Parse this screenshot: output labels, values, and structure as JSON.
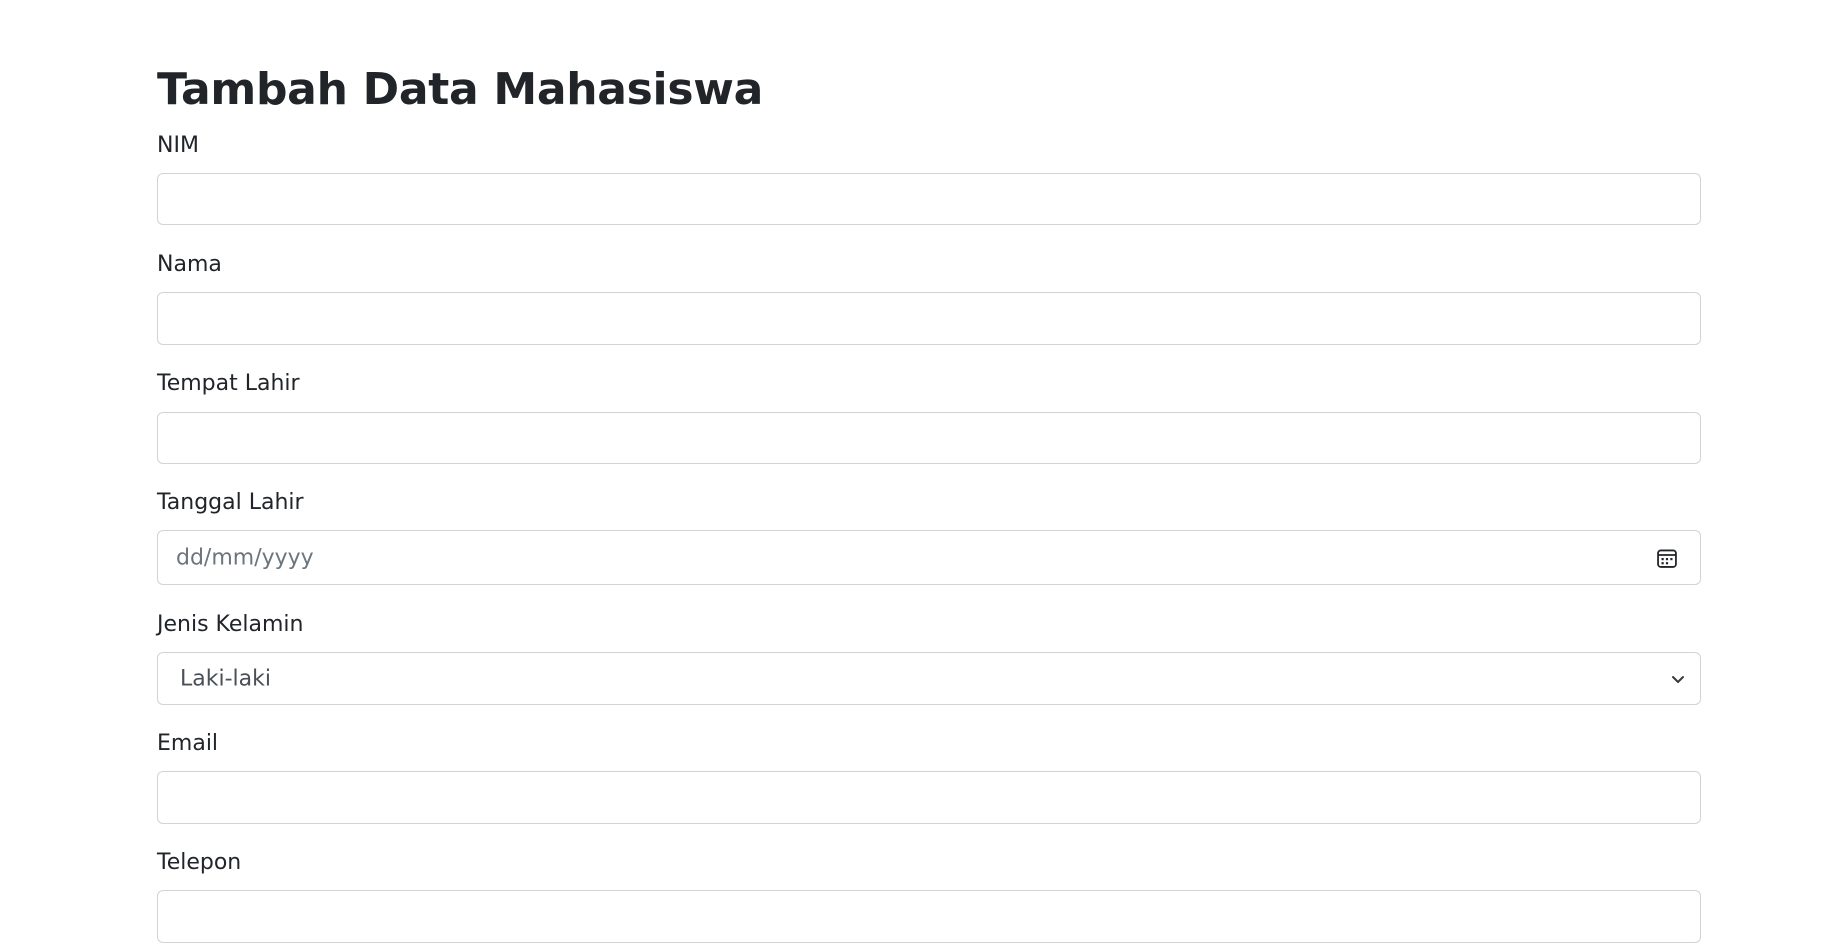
{
  "page": {
    "title": "Tambah Data Mahasiswa"
  },
  "form": {
    "nim": {
      "label": "NIM",
      "value": ""
    },
    "nama": {
      "label": "Nama",
      "value": ""
    },
    "tempat_lahir": {
      "label": "Tempat Lahir",
      "value": ""
    },
    "tanggal_lahir": {
      "label": "Tanggal Lahir",
      "placeholder": "dd/mm/yyyy",
      "icon": "calendar-icon"
    },
    "jenis_kelamin": {
      "label": "Jenis Kelamin",
      "selected": "Laki-laki",
      "icon": "chevron-down-icon"
    },
    "email": {
      "label": "Email",
      "value": ""
    },
    "telepon": {
      "label": "Telepon",
      "value": ""
    }
  },
  "colors": {
    "text": "#212529",
    "border": "#ced4da",
    "placeholder": "#6c757d"
  }
}
